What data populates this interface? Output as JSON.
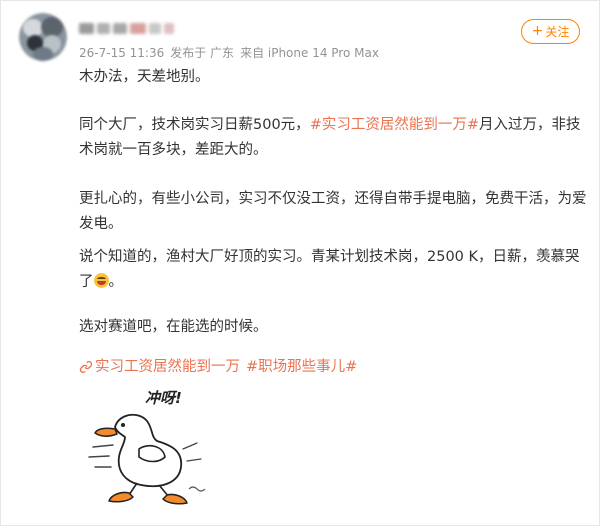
{
  "post": {
    "author": {
      "avatar_colors": [
        "#6f7a86",
        "#9aa4ad",
        "#d4d8dc",
        "#2d3339",
        "#b9c0c6",
        "#575f68"
      ],
      "name_blur_colors": [
        "#9a9a9a",
        "#b4b4b4",
        "#d9a0a0",
        "#c8c8c8"
      ]
    },
    "meta": {
      "time": "26-7-15 11:36",
      "via": "发布于 广东",
      "device": "来自 iPhone 14 Pro Max"
    },
    "follow": {
      "icon": "+",
      "label": "关注"
    },
    "paragraphs": {
      "p1": "木办法，天差地别。",
      "p2_before": "同个大厂，技术岗实习日薪500元，",
      "p2_tag": "#实习工资居然能到一万#",
      "p2_after": "月入过万，非技术岗就一百多块，差距大的。",
      "p3": "更扎心的，有些小公司，实习不仅没工资，还得自带手提电脑，免费干活，为爱发电。",
      "p4": "说个知道的，渔村大厂好顶的实习。青某计划技术岗，2500 K，日薪，羡慕哭了",
      "p4_end": "。",
      "p5": "选对赛道吧，在能选的时候。"
    },
    "topics": [
      "实习工资居然能到一万",
      "#职场那些事儿#"
    ],
    "illustration": {
      "caption": "冲呀!",
      "icon": "running-duck-sticker"
    },
    "colors": {
      "accent": "#ff8200",
      "hashtag": "#eb7350",
      "meta": "#939393",
      "text": "#333333"
    }
  }
}
